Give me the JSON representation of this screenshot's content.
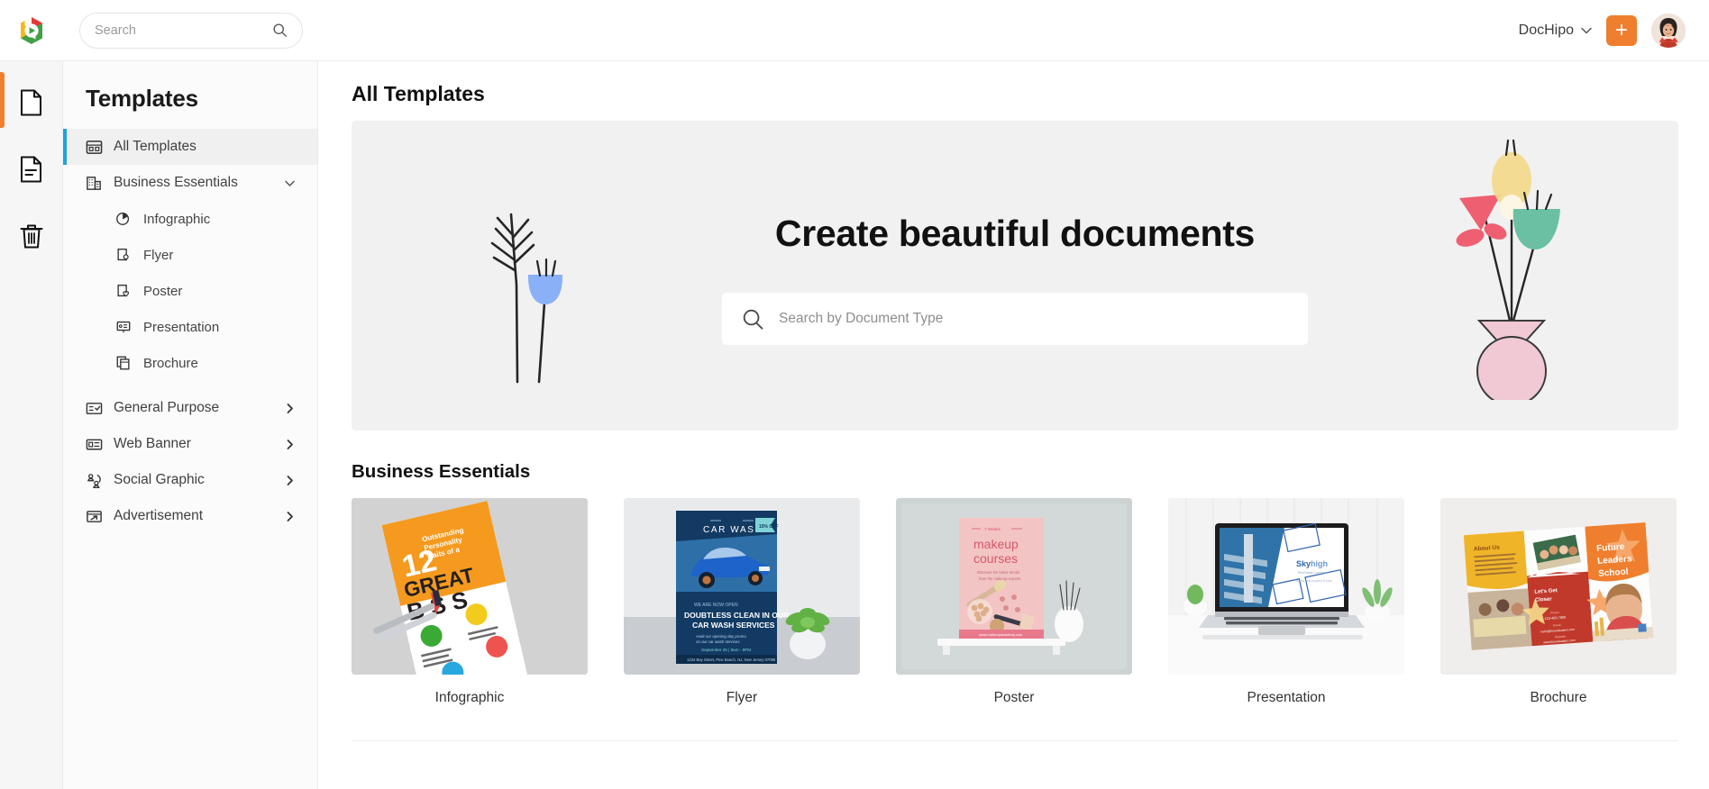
{
  "brand": {
    "logo_icon": "dochipo-logo-icon",
    "accent_orange": "#ef7f2e",
    "accent_blue": "#1fa2e0"
  },
  "topbar": {
    "search": {
      "value": "",
      "placeholder": "Search",
      "icon": "search-icon"
    },
    "account_name": "DocHipo",
    "account_chevron_icon": "chevron-down-icon",
    "create_button_label": "+",
    "avatar_icon": "user-avatar"
  },
  "rail": {
    "items": [
      {
        "name": "documents",
        "icon": "document-icon",
        "active": true
      },
      {
        "name": "my-designs",
        "icon": "document-lines-icon",
        "active": false
      },
      {
        "name": "trash",
        "icon": "trash-icon",
        "active": false
      }
    ]
  },
  "sidebar": {
    "title": "Templates",
    "items": [
      {
        "label": "All Templates",
        "icon": "grid-layout-icon",
        "active": true,
        "expandable": false
      },
      {
        "label": "Business Essentials",
        "icon": "building-icon",
        "active": false,
        "expandable": true,
        "expanded": true
      },
      {
        "label": "General Purpose",
        "icon": "checklist-icon",
        "active": false,
        "expandable": true,
        "expanded": false
      },
      {
        "label": "Web Banner",
        "icon": "banner-icon",
        "active": false,
        "expandable": true,
        "expanded": false
      },
      {
        "label": "Social Graphic",
        "icon": "people-network-icon",
        "active": false,
        "expandable": true,
        "expanded": false
      },
      {
        "label": "Advertisement",
        "icon": "ad-arrow-icon",
        "active": false,
        "expandable": true,
        "expanded": false
      }
    ],
    "business_essentials_children": [
      {
        "label": "Infographic",
        "icon": "pie-chart-icon"
      },
      {
        "label": "Flyer",
        "icon": "flyer-icon"
      },
      {
        "label": "Poster",
        "icon": "poster-heart-icon"
      },
      {
        "label": "Presentation",
        "icon": "presentation-icon"
      },
      {
        "label": "Brochure",
        "icon": "brochure-icon"
      }
    ]
  },
  "main": {
    "page_title": "All Templates",
    "hero": {
      "title": "Create beautiful documents",
      "search": {
        "value": "",
        "placeholder": "Search by Document Type",
        "icon": "search-icon"
      },
      "left_art": "fern-and-blue-tulip-illustration",
      "right_art": "pink-vase-with-flowers-illustration"
    },
    "section": {
      "heading": "Business Essentials",
      "cards": [
        {
          "label": "Infographic",
          "thumb": "infographic-great-boss-mockup"
        },
        {
          "label": "Flyer",
          "thumb": "car-wash-flyer-mockup"
        },
        {
          "label": "Poster",
          "thumb": "makeup-courses-poster-mockup"
        },
        {
          "label": "Presentation",
          "thumb": "skyhigh-laptop-presentation-mockup"
        },
        {
          "label": "Brochure",
          "thumb": "future-leaders-school-brochure-mockup"
        }
      ]
    }
  }
}
